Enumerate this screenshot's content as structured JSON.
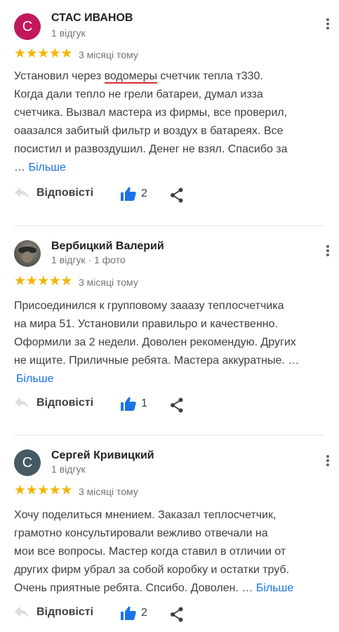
{
  "labels": {
    "reply": "Відповісті",
    "more": "Більше"
  },
  "colors": {
    "star": "#f4b400",
    "like": "#1a73e8",
    "link": "#1a73e8",
    "underline": "#d32f2f"
  },
  "reviews": [
    {
      "avatar_letter": "С",
      "avatar_color": "#c2185b",
      "name": "СТАС ИВАНОВ",
      "meta": "1 відгук",
      "rating": 5,
      "date": "3 місяці тому",
      "lines": [
        {
          "before": "Установил через ",
          "underlined": "водомеры",
          "after": " счетчик тепла т330."
        },
        {
          "text": "Когда дали тепло не грели батареи, думал изза"
        },
        {
          "text": "счетчика. Вызвал мастера из фирмы, все проверил,"
        },
        {
          "text": "оаазался забитый фильтр и воздух в батареях. Все"
        },
        {
          "text": "посистил и развоздушил. Денег не взял. Спасибо за"
        }
      ],
      "ellipsis": "…",
      "likes": "2"
    },
    {
      "avatar_icon": "profile-photo",
      "name": "Вербицкий Валерий",
      "meta": "1 відгук · 1 фото",
      "rating": 5,
      "date": "3 місяці тому",
      "lines": [
        "Присоединился к групповому зааазу теплосчетчика",
        "на мира 51. Установили правильро и качественно.",
        "Оформили за 2 недели. Доволен рекомендую. Других",
        "не ищите. Приличные ребята. Мастера аккуратные. …"
      ],
      "likes": "1"
    },
    {
      "avatar_letter": "С",
      "avatar_color": "#455a64",
      "name": "Сергей Кривицкий",
      "meta": "1 відгук",
      "rating": 5,
      "date": "3 місяці тому",
      "lines": [
        "Хочу поделиться мнением. Заказал теплосчетчик,",
        "грамотно консультировали вежливо отвечали на",
        "мои все вопросы. Мастер когда ставил в отличии от",
        "других фирм убрал за собой коробку и остатки труб."
      ],
      "last_line": "Очень приятные ребята. Спсибо. Доволен. …",
      "likes": "2"
    }
  ]
}
